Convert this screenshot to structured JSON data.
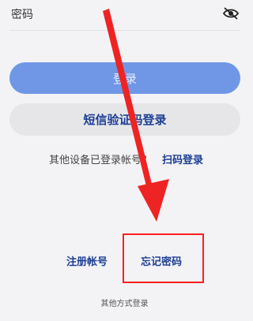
{
  "password": {
    "label": "密码",
    "toggle_icon": "eye-slash-icon"
  },
  "buttons": {
    "login_label": "登录",
    "sms_login_label": "短信验证码登录"
  },
  "other_device": {
    "prompt": "其他设备已登录帐号？",
    "scan_login_label": "扫码登录"
  },
  "links": {
    "register_label": "注册帐号",
    "forgot_password_label": "忘记密码"
  },
  "footer": {
    "other_methods_label": "其他方式登录"
  },
  "annotations": {
    "arrow_color": "#ee2323",
    "highlight_color": "#ff1e1e"
  },
  "colors": {
    "accent": "#1f3f94",
    "login_button": "#6f97e6",
    "background": "#f3f3f5"
  }
}
